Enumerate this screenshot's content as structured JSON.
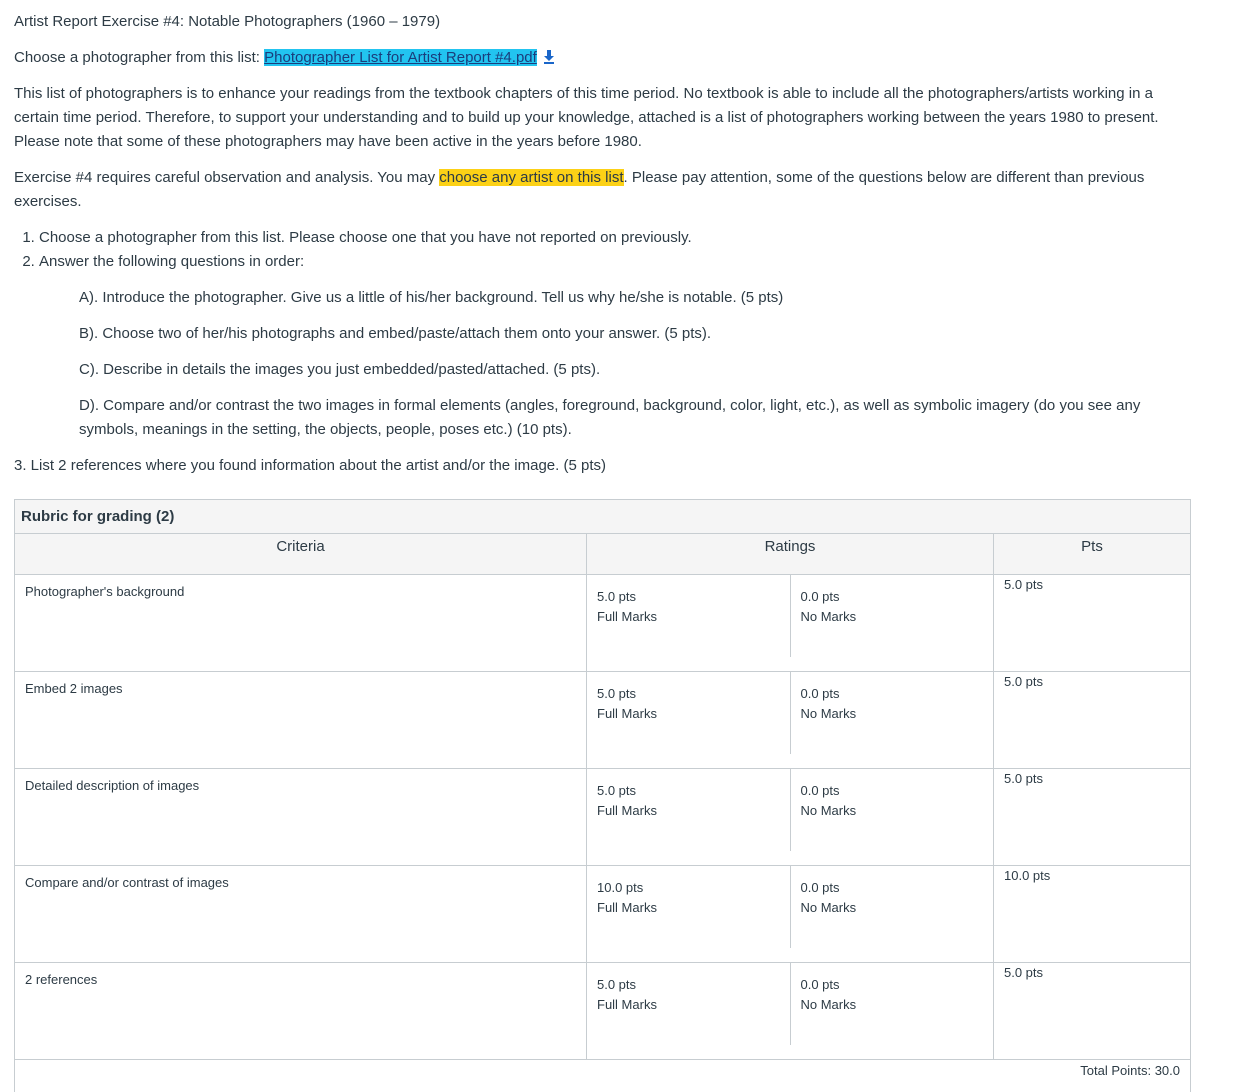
{
  "assignment": {
    "heading": "Artist Report Exercise #4: Notable Photographers (1960 – 1979)",
    "choose_prefix": "Choose a photographer from this list: ",
    "file_link": "Photographer List for Artist Report #4.pdf",
    "intro": "This list of photographers is to enhance your readings from the textbook chapters of this time period. No textbook is able to include all the photographers/artists working in a certain time period. Therefore, to support your understanding and to build up your knowledge, attached is a list of photographers working between the years 1980 to present. Please note that some of these photographers may have been active in the years before 1980.",
    "requirements_prefix": "Exercise #4 requires careful observation and analysis.  You may ",
    "requirements_highlight": "choose any artist on this list",
    "requirements_suffix": ". Please pay attention, some of the questions below are different than previous exercises.",
    "steps": [
      "Choose a photographer from this list. Please choose one that you have not reported on previously.",
      "Answer the following questions in order:"
    ],
    "subquestions": [
      "A). Introduce the photographer. Give us a little of his/her background. Tell us why he/she is notable. (5 pts)",
      "B). Choose two of her/his photographs and embed/paste/attach them onto your answer. (5 pts).",
      "C). Describe in details the images you just embedded/pasted/attached. (5 pts).",
      "D). Compare and/or contrast the two images in formal elements (angles, foreground, background, color, light, etc.), as well as symbolic imagery (do you see any symbols, meanings in the setting, the objects, people, poses etc.) (10 pts)."
    ],
    "step3": "3.   List 2 references where you found information about the artist and/or the image. (5 pts)"
  },
  "rubric": {
    "title": "Rubric for grading (2)",
    "headers": {
      "criteria": "Criteria",
      "ratings": "Ratings",
      "pts": "Pts"
    },
    "rows": [
      {
        "criteria": "Photographer's background",
        "full_pts": "5.0 pts",
        "full_label": "Full Marks",
        "no_pts": "0.0 pts",
        "no_label": "No Marks",
        "pts": "5.0 pts"
      },
      {
        "criteria": "Embed 2 images",
        "full_pts": "5.0 pts",
        "full_label": "Full Marks",
        "no_pts": "0.0 pts",
        "no_label": "No Marks",
        "pts": "5.0 pts"
      },
      {
        "criteria": "Detailed description of images",
        "full_pts": "5.0 pts",
        "full_label": "Full Marks",
        "no_pts": "0.0 pts",
        "no_label": "No Marks",
        "pts": "5.0 pts"
      },
      {
        "criteria": "Compare and/or contrast of images",
        "full_pts": "10.0 pts",
        "full_label": "Full Marks",
        "no_pts": "0.0 pts",
        "no_label": "No Marks",
        "pts": "10.0 pts"
      },
      {
        "criteria": "2 references",
        "full_pts": "5.0 pts",
        "full_label": "Full Marks",
        "no_pts": "0.0 pts",
        "no_label": "No Marks",
        "pts": "5.0 pts"
      }
    ],
    "total": "Total Points: 30.0"
  }
}
